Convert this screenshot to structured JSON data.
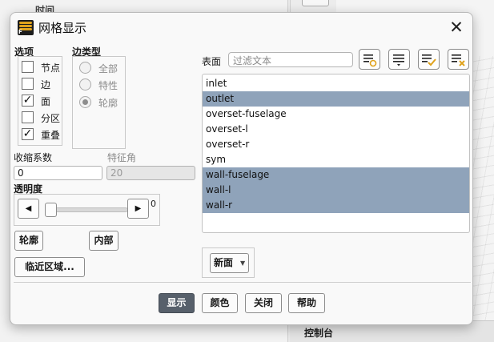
{
  "background": {
    "left_panel_title": "时间",
    "console_label": "控制台"
  },
  "dialog": {
    "title": "网格显示",
    "close_glyph": "✕"
  },
  "options": {
    "header": "选项",
    "items": [
      {
        "label": "节点",
        "checked": false
      },
      {
        "label": "边",
        "checked": false
      },
      {
        "label": "面",
        "checked": true
      },
      {
        "label": "分区",
        "checked": false
      },
      {
        "label": "重叠",
        "checked": true
      }
    ]
  },
  "edge_type": {
    "header": "边类型",
    "items": [
      {
        "label": "全部",
        "selected": false
      },
      {
        "label": "特性",
        "selected": false
      },
      {
        "label": "轮廓",
        "selected": true
      }
    ]
  },
  "shrink": {
    "label": "收缩系数",
    "value": "0"
  },
  "feature_angle": {
    "label": "特征角",
    "value": "20"
  },
  "transparency": {
    "label": "透明度",
    "value": "0",
    "level": 0
  },
  "left_buttons": {
    "outline": "轮廓",
    "interior": "内部",
    "proximity": "临近区域..."
  },
  "surfaces": {
    "label": "表面",
    "filter_placeholder": "过滤文本",
    "items": [
      {
        "name": "inlet",
        "selected": false
      },
      {
        "name": "outlet",
        "selected": true
      },
      {
        "name": "overset-fuselage",
        "selected": false
      },
      {
        "name": "overset-l",
        "selected": false
      },
      {
        "name": "overset-r",
        "selected": false
      },
      {
        "name": "sym",
        "selected": false
      },
      {
        "name": "wall-fuselage",
        "selected": true
      },
      {
        "name": "wall-l",
        "selected": true
      },
      {
        "name": "wall-r",
        "selected": true
      }
    ],
    "new_surface_label": "新面",
    "tools": [
      "filter-options-icon",
      "list-options-icon",
      "select-all-icon",
      "deselect-all-icon"
    ]
  },
  "footer": {
    "display": "显示",
    "colors": "颜色",
    "close": "关闭",
    "help": "帮助"
  },
  "colors": {
    "selection": "#8fa3ba",
    "primary_button": "#57606b",
    "accent_icon": "#e0a21c"
  }
}
